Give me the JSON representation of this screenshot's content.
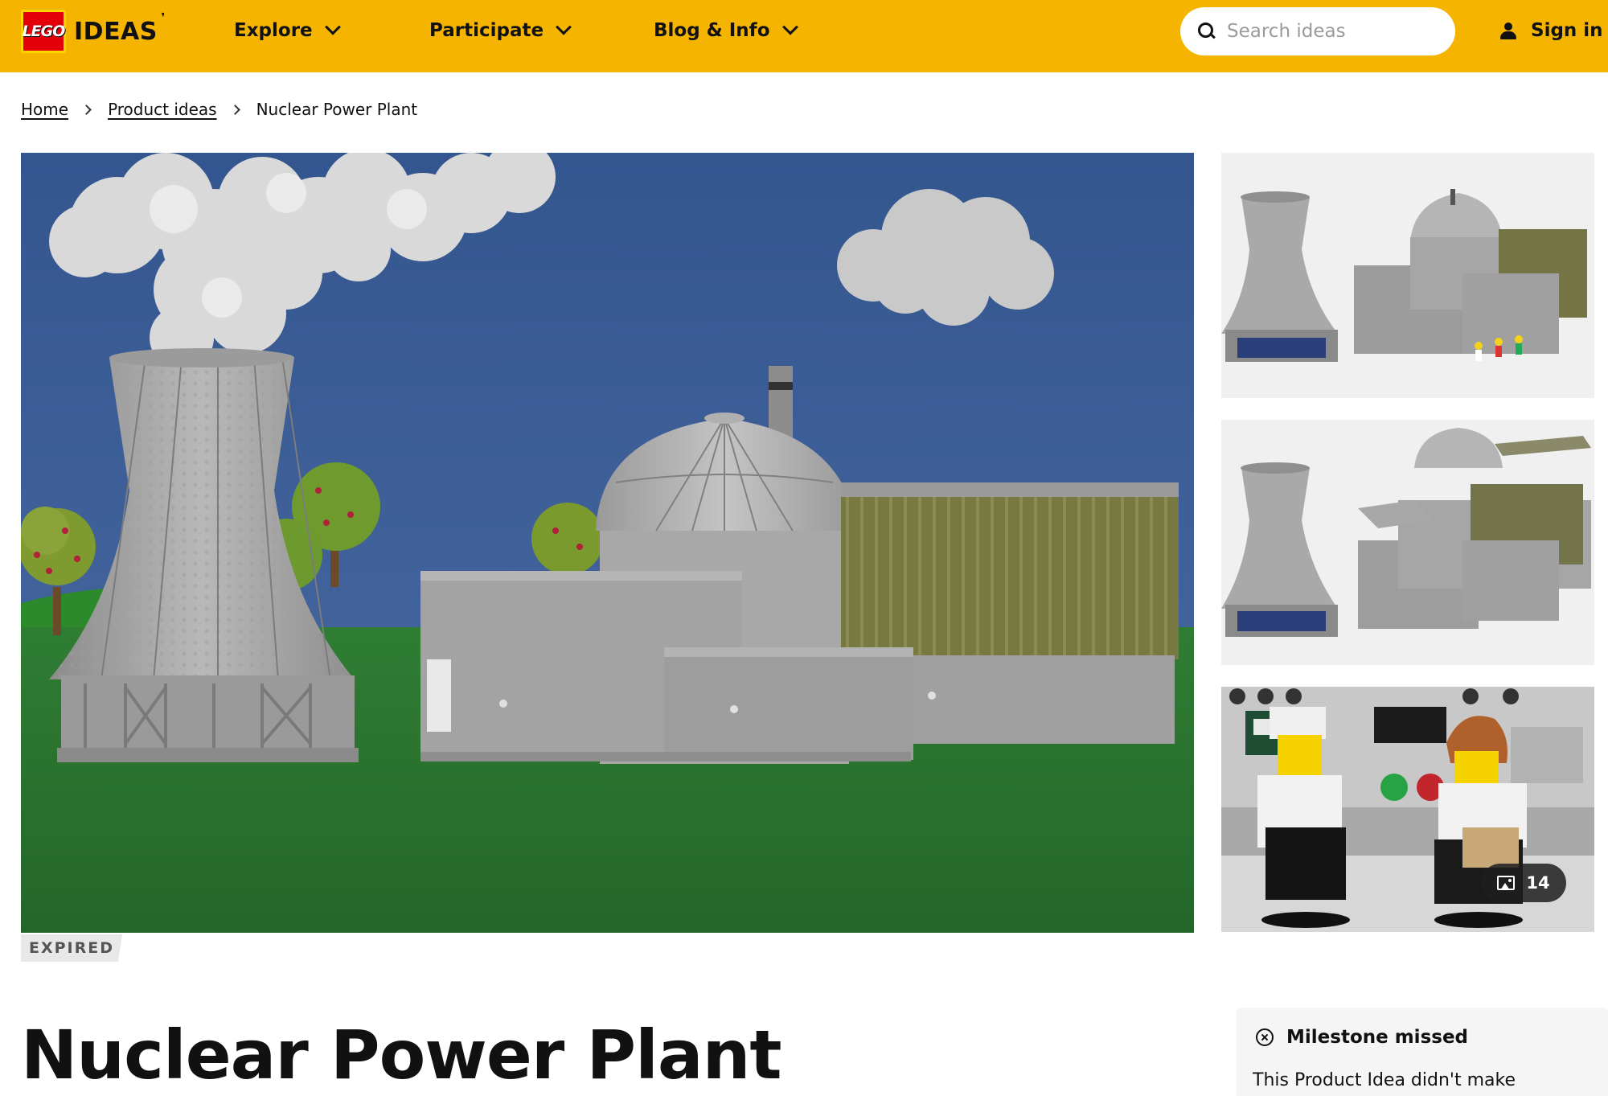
{
  "header": {
    "logo_brand": "LEGO",
    "logo_product": "IDEAS",
    "nav": [
      {
        "label": "Explore"
      },
      {
        "label": "Participate"
      },
      {
        "label": "Blog & Info"
      }
    ],
    "search_placeholder": "Search ideas",
    "signin_label": "Sign in",
    "bg_color": "#f5b400"
  },
  "breadcrumb": {
    "home": "Home",
    "product_ideas": "Product ideas",
    "current": "Nuclear Power Plant"
  },
  "gallery": {
    "photo_count": "14",
    "status": "EXPIRED"
  },
  "title": "Nuclear Power Plant",
  "milestone": {
    "heading": "Milestone missed",
    "text": "This Product Idea didn't make"
  },
  "colors": {
    "sky": "#3e5f96",
    "grass": "#2f7a32",
    "hill": "#2e8a2e",
    "brick_gray": "#a6a6a6",
    "olive": "#7a7a46"
  }
}
